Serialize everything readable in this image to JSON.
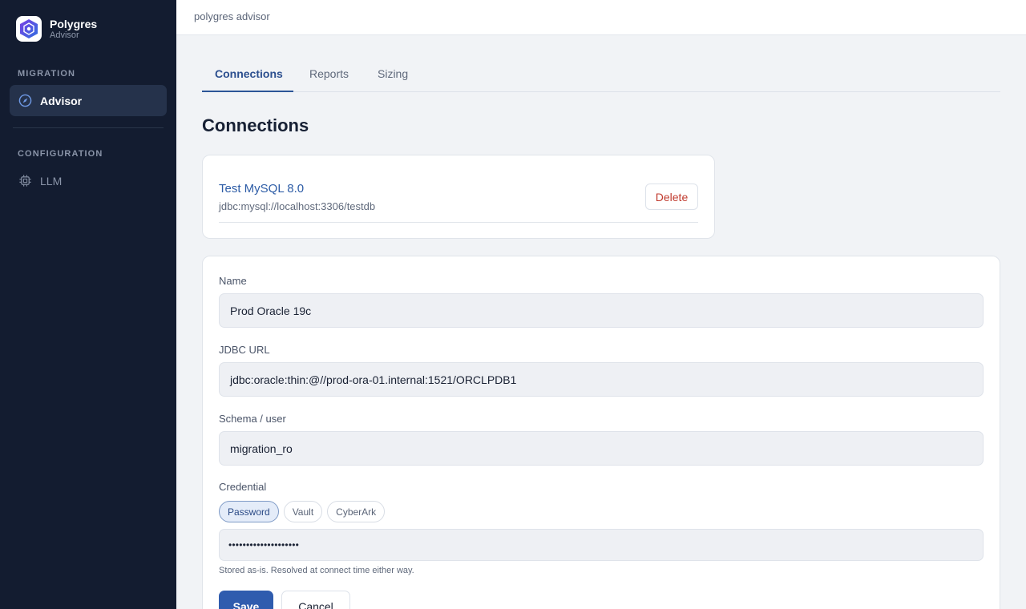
{
  "app": {
    "name": "Polygres",
    "subtitle": "Advisor",
    "logo_icon": "polygres-logo-icon"
  },
  "sidebar": {
    "sections": [
      {
        "title": "MIGRATION",
        "items": [
          {
            "label": "Advisor",
            "icon": "compass-icon",
            "active": true
          }
        ]
      },
      {
        "title": "CONFIGURATION",
        "items": [
          {
            "label": "LLM",
            "icon": "chip-icon",
            "active": false
          }
        ]
      }
    ]
  },
  "topbar": {
    "title": "polygres advisor"
  },
  "tabs": [
    {
      "label": "Connections",
      "active": true
    },
    {
      "label": "Reports",
      "active": false
    },
    {
      "label": "Sizing",
      "active": false
    }
  ],
  "page": {
    "title": "Connections"
  },
  "connections": [
    {
      "name": "Test MySQL 8.0",
      "url": "jdbc:mysql://localhost:3306/testdb",
      "delete_label": "Delete"
    }
  ],
  "form": {
    "name": {
      "label": "Name",
      "value": "Prod Oracle 19c"
    },
    "jdbc_url": {
      "label": "JDBC URL",
      "value": "jdbc:oracle:thin:@//prod-ora-01.internal:1521/ORCLPDB1"
    },
    "schema": {
      "label": "Schema / user",
      "value": "migration_ro"
    },
    "credential": {
      "label": "Credential",
      "options": [
        "Password",
        "Vault",
        "CyberArk"
      ],
      "selected": "Password",
      "masked_value": "••••••••••••••••••••",
      "hint": "Stored as-is. Resolved at connect time either way."
    },
    "save_label": "Save",
    "cancel_label": "Cancel"
  },
  "colors": {
    "sidebar_bg": "#131c30",
    "accent": "#2f5cae",
    "danger": "#c13b2f",
    "link": "#2d5ca6"
  }
}
